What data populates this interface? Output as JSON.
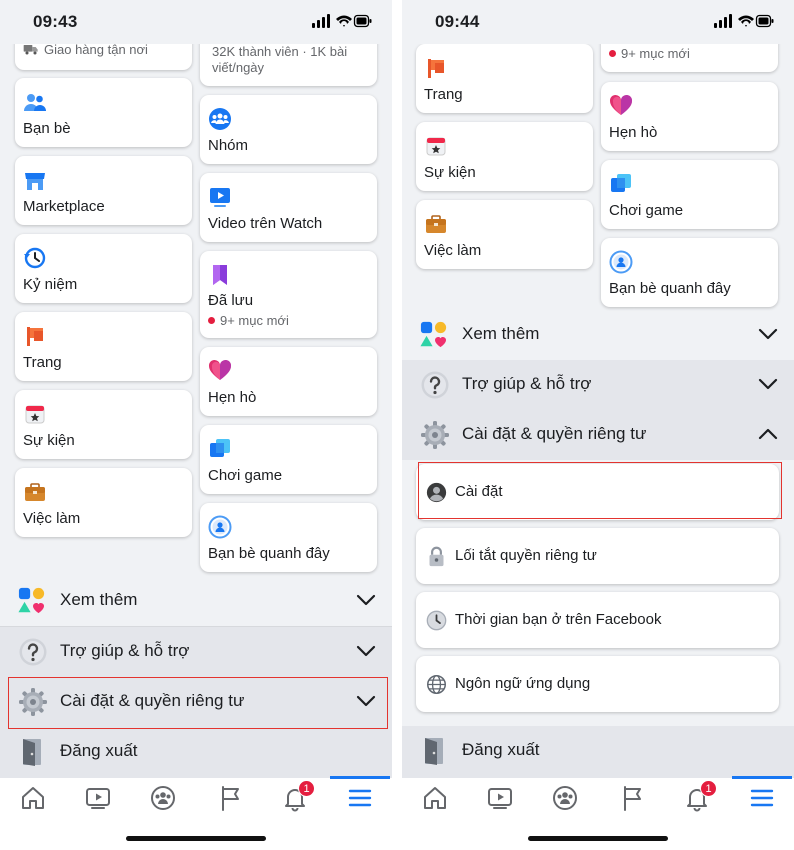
{
  "left": {
    "time": "09:43",
    "col1": [
      {
        "label": "Giao hàng tận nơi",
        "icon": "delivery-truck-icon"
      },
      {
        "label": "Bạn bè",
        "icon": "friends-icon"
      },
      {
        "label": "Marketplace",
        "icon": "marketplace-icon"
      },
      {
        "label": "Kỷ niệm",
        "icon": "memories-icon"
      },
      {
        "label": "Trang",
        "icon": "pages-flag-icon"
      },
      {
        "label": "Sự kiện",
        "icon": "events-calendar-icon"
      },
      {
        "label": "Việc làm",
        "icon": "jobs-briefcase-icon"
      }
    ],
    "col2": [
      {
        "sub": "32K thành viên · 1K bài viết/ngày"
      },
      {
        "label": "Nhóm",
        "icon": "groups-icon"
      },
      {
        "label": "Video trên Watch",
        "icon": "watch-video-icon"
      },
      {
        "label": "Đã lưu",
        "sub": "9+ mục mới",
        "icon": "saved-bookmark-icon"
      },
      {
        "label": "Hẹn hò",
        "icon": "dating-heart-icon"
      },
      {
        "label": "Chơi game",
        "icon": "gaming-icon"
      },
      {
        "label": "Bạn bè quanh đây",
        "icon": "nearby-friends-icon"
      }
    ],
    "rows": {
      "see_more": "Xem thêm",
      "help": "Trợ giúp & hỗ trợ",
      "settings_privacy": "Cài đặt & quyền riêng tư",
      "logout": "Đăng xuất"
    },
    "notification_count": "1"
  },
  "right": {
    "time": "09:44",
    "col1": [
      {
        "label": "Trang",
        "icon": "pages-flag-icon"
      },
      {
        "label": "Sự kiện",
        "icon": "events-calendar-icon"
      },
      {
        "label": "Việc làm",
        "icon": "jobs-briefcase-icon"
      }
    ],
    "col2": [
      {
        "sub": "9+ mục mới"
      },
      {
        "label": "Hẹn hò",
        "icon": "dating-heart-icon"
      },
      {
        "label": "Chơi game",
        "icon": "gaming-icon"
      },
      {
        "label": "Bạn bè quanh đây",
        "icon": "nearby-friends-icon"
      }
    ],
    "rows": {
      "see_more": "Xem thêm",
      "help": "Trợ giúp & hỗ trợ",
      "settings_privacy": "Cài đặt & quyền riêng tư",
      "logout": "Đăng xuất"
    },
    "settings_items": [
      {
        "label": "Cài đặt",
        "icon": "account-settings-icon"
      },
      {
        "label": "Lối tắt quyền riêng tư",
        "icon": "privacy-lock-icon"
      },
      {
        "label": "Thời gian bạn ở trên Facebook",
        "icon": "clock-icon"
      },
      {
        "label": "Ngôn ngữ ứng dụng",
        "icon": "globe-icon"
      }
    ],
    "notification_count": "1"
  },
  "colors": {
    "accent": "#1877f2",
    "highlight_border": "#e3342f",
    "badge": "#e41e3f"
  }
}
